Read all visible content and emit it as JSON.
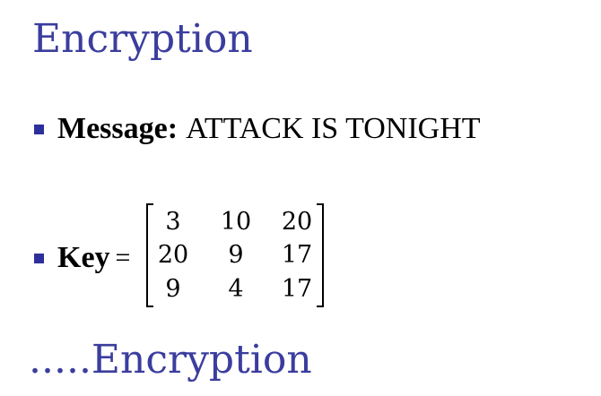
{
  "slide": {
    "title": "Encryption",
    "footer_title": ".....Encryption"
  },
  "message": {
    "label": "Message:",
    "value": "ATTACK IS TONIGHT"
  },
  "key": {
    "label": "Key",
    "equals": "=",
    "matrix": [
      [
        "3",
        "10",
        "20"
      ],
      [
        "20",
        "9",
        "17"
      ],
      [
        "9",
        "4",
        "17"
      ]
    ]
  },
  "colors": {
    "title": "#3b3d9e",
    "bullet": "#2d2f9a",
    "text": "#000000"
  }
}
